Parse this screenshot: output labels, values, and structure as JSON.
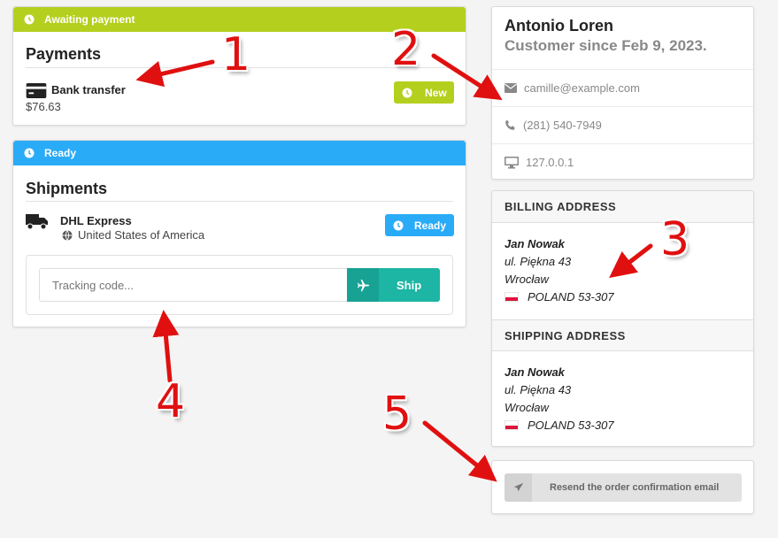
{
  "payment": {
    "status": "Awaiting payment",
    "title": "Payments",
    "method": "Bank transfer",
    "amount": "$76.63",
    "badge": "New",
    "colors": {
      "ribbon": "#b5cf1e",
      "badge": "#b5cf1e"
    }
  },
  "shipment": {
    "status": "Ready",
    "title": "Shipments",
    "carrier": "DHL Express",
    "country": "United States of America",
    "badge": "Ready",
    "tracking_placeholder": "Tracking code...",
    "ship_label": "Ship",
    "colors": {
      "ribbon": "#2aabf7",
      "badge": "#2aabf7",
      "ship": "#1db5a3"
    }
  },
  "customer": {
    "name": "Antonio Loren",
    "since": "Customer since Feb 9, 2023.",
    "email": "camille@example.com",
    "phone": "(281) 540-7949",
    "ip": "127.0.0.1"
  },
  "billing": {
    "title": "BILLING ADDRESS",
    "name": "Jan Nowak",
    "street": "ul. Piękna 43",
    "city": "Wrocław",
    "country_line": "POLAND 53-307"
  },
  "shipping": {
    "title": "SHIPPING ADDRESS",
    "name": "Jan Nowak",
    "street": "ul. Piękna 43",
    "city": "Wrocław",
    "country_line": "POLAND 53-307"
  },
  "resend": {
    "label": "Resend the order confirmation email"
  },
  "annotations": [
    "1",
    "2",
    "3",
    "4",
    "5"
  ]
}
